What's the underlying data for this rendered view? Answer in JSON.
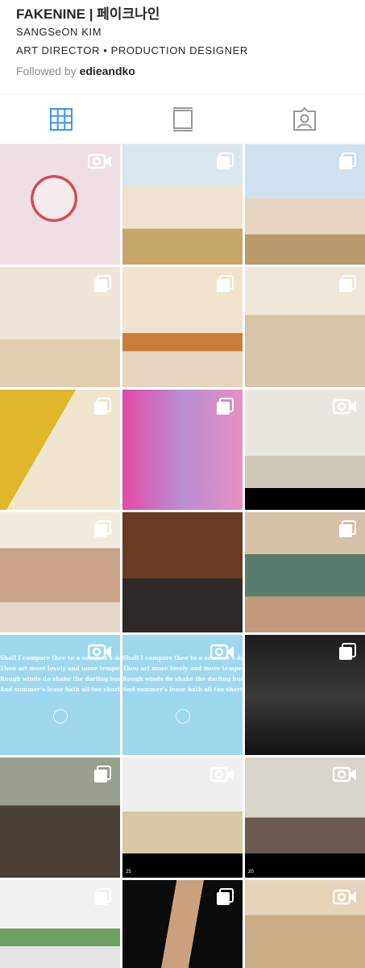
{
  "profile": {
    "username": "FAKENINE",
    "separator": " | ",
    "korean_name": "페이크나인",
    "full_name": "SANGSeON KIM",
    "role": "ART DIRECTOR • PRODUCTION DESIGNER",
    "followed_prefix": "Followed by ",
    "followed_by": "edieandko"
  },
  "tabs": [
    {
      "name": "grid",
      "icon": "grid-icon",
      "active": true
    },
    {
      "name": "feed",
      "icon": "feed-icon",
      "active": false
    },
    {
      "name": "tagged",
      "icon": "tagged-icon",
      "active": false
    }
  ],
  "posts": [
    {
      "type": "video",
      "subject": "clock"
    },
    {
      "type": "multiple",
      "subject": "group-kitchen"
    },
    {
      "type": "multiple",
      "subject": "group-pose"
    },
    {
      "type": "multiple",
      "subject": "cafe-scene"
    },
    {
      "type": "multiple",
      "subject": "diner-scene"
    },
    {
      "type": "multiple",
      "subject": "crouching-pose"
    },
    {
      "type": "multiple",
      "subject": "plaid-portrait"
    },
    {
      "type": "multiple",
      "subject": "group-pink"
    },
    {
      "type": "video",
      "subject": "living-room-group"
    },
    {
      "type": "multiple",
      "subject": "portrait-window"
    },
    {
      "type": "multiple",
      "subject": "wood-room"
    },
    {
      "type": "multiple",
      "subject": "table-group"
    },
    {
      "type": "video",
      "subject": "sonnet-card"
    },
    {
      "type": "video",
      "subject": "sonnet-card"
    },
    {
      "type": "multiple",
      "subject": "bw-group"
    },
    {
      "type": "multiple",
      "subject": "couch-scene"
    },
    {
      "type": "video",
      "subject": "field"
    },
    {
      "type": "video",
      "subject": "silhouette"
    },
    {
      "type": "multiple",
      "subject": "plants"
    },
    {
      "type": "multiple",
      "subject": "shadow-portrait"
    },
    {
      "type": "video",
      "subject": "sunglasses-portrait"
    }
  ],
  "sonnet": {
    "line1": "Shall I compare thee to a summer's day?",
    "line2": "Thou art more lovely and more temperate:",
    "line3": "Rough winds do shake the darling buds of May,",
    "line4": "And summer's lease hath all too short a date;"
  },
  "frame_numbers": {
    "p16": "25",
    "p17": "20"
  },
  "colors": {
    "accent": "#3897f0",
    "text": "#262626",
    "muted": "#8e8e8e",
    "divider": "#efefef"
  }
}
